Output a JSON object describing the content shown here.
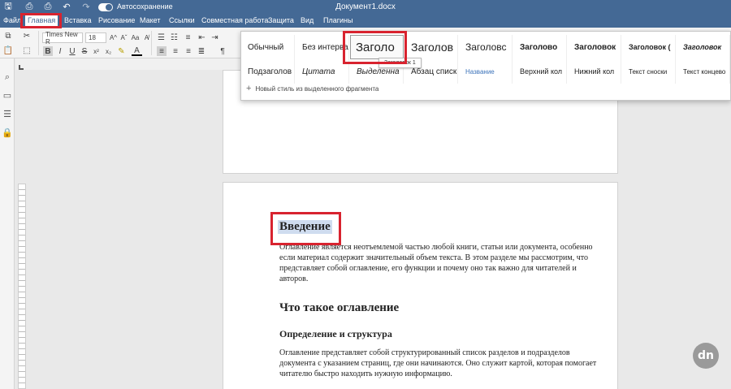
{
  "app": {
    "title": "Документ1.docx",
    "autosave_label": "Автосохранение",
    "autosave_on": true
  },
  "quick_access": [
    {
      "icon": "save-icon",
      "glyph": "🖫"
    },
    {
      "icon": "print-icon",
      "glyph": "⎙"
    },
    {
      "icon": "quick-print-icon",
      "glyph": "⎙"
    },
    {
      "icon": "undo-icon",
      "glyph": "↶"
    },
    {
      "icon": "redo-icon",
      "glyph": "↷"
    }
  ],
  "menu": {
    "tabs": [
      "Файл",
      "Главная",
      "Вставка",
      "Рисование",
      "Макет",
      "Ссылки",
      "Совместная работа",
      "Защита",
      "Вид",
      "Плагины"
    ],
    "active_tab": "Главная"
  },
  "toolbar": {
    "font_name": "Times New R",
    "font_size": "18",
    "bold": "B",
    "italic": "I",
    "underline": "U",
    "strike": "S",
    "superscript": "x²",
    "subscript": "x₂",
    "grow_font": "A^",
    "shrink_font": "Aˇ",
    "case": "Aa",
    "clear": "A̸",
    "highlight": "✎",
    "font_color": "A",
    "paragraph_mark": "¶"
  },
  "styles_gallery": {
    "row1": [
      "Обычный",
      "Без интервал",
      "Заголо",
      "Заголов",
      "Заголовс",
      "Заголово",
      "Заголовок",
      "Заголовок (",
      "Заголовок"
    ],
    "row2": [
      "Подзаголов",
      "Цитата",
      "Выделенна",
      "Абзац списк",
      "Название",
      "Верхний кол",
      "Нижний кол",
      "Текст сноски",
      "Текст концево"
    ],
    "selected": "Заголо",
    "tooltip": "Заголовок 1",
    "new_style_label": "Новый стиль из выделенного фрагмента",
    "accent_color": "#3c73ba"
  },
  "document": {
    "heading1": "Введение",
    "paragraph1": "Оглавление является неотъемлемой частью любой книги, статьи или документа, особенно если материал содержит значительный объем текста. В этом разделе мы рассмотрим, что представляет собой оглавление, его функции и почему оно так важно для читателей и авторов.",
    "heading2": "Что такое оглавление",
    "heading3": "Определение и структура",
    "paragraph2": "Оглавление представляет собой структурированный список разделов и подразделов документа с указанием страниц, где они начинаются. Оно служит картой, которая помогает читателю быстро находить нужную информацию."
  },
  "colors": {
    "brand": "#446995",
    "highlight_frame": "#d8232f",
    "selection": "#cfdcef"
  },
  "watermark": "dn"
}
